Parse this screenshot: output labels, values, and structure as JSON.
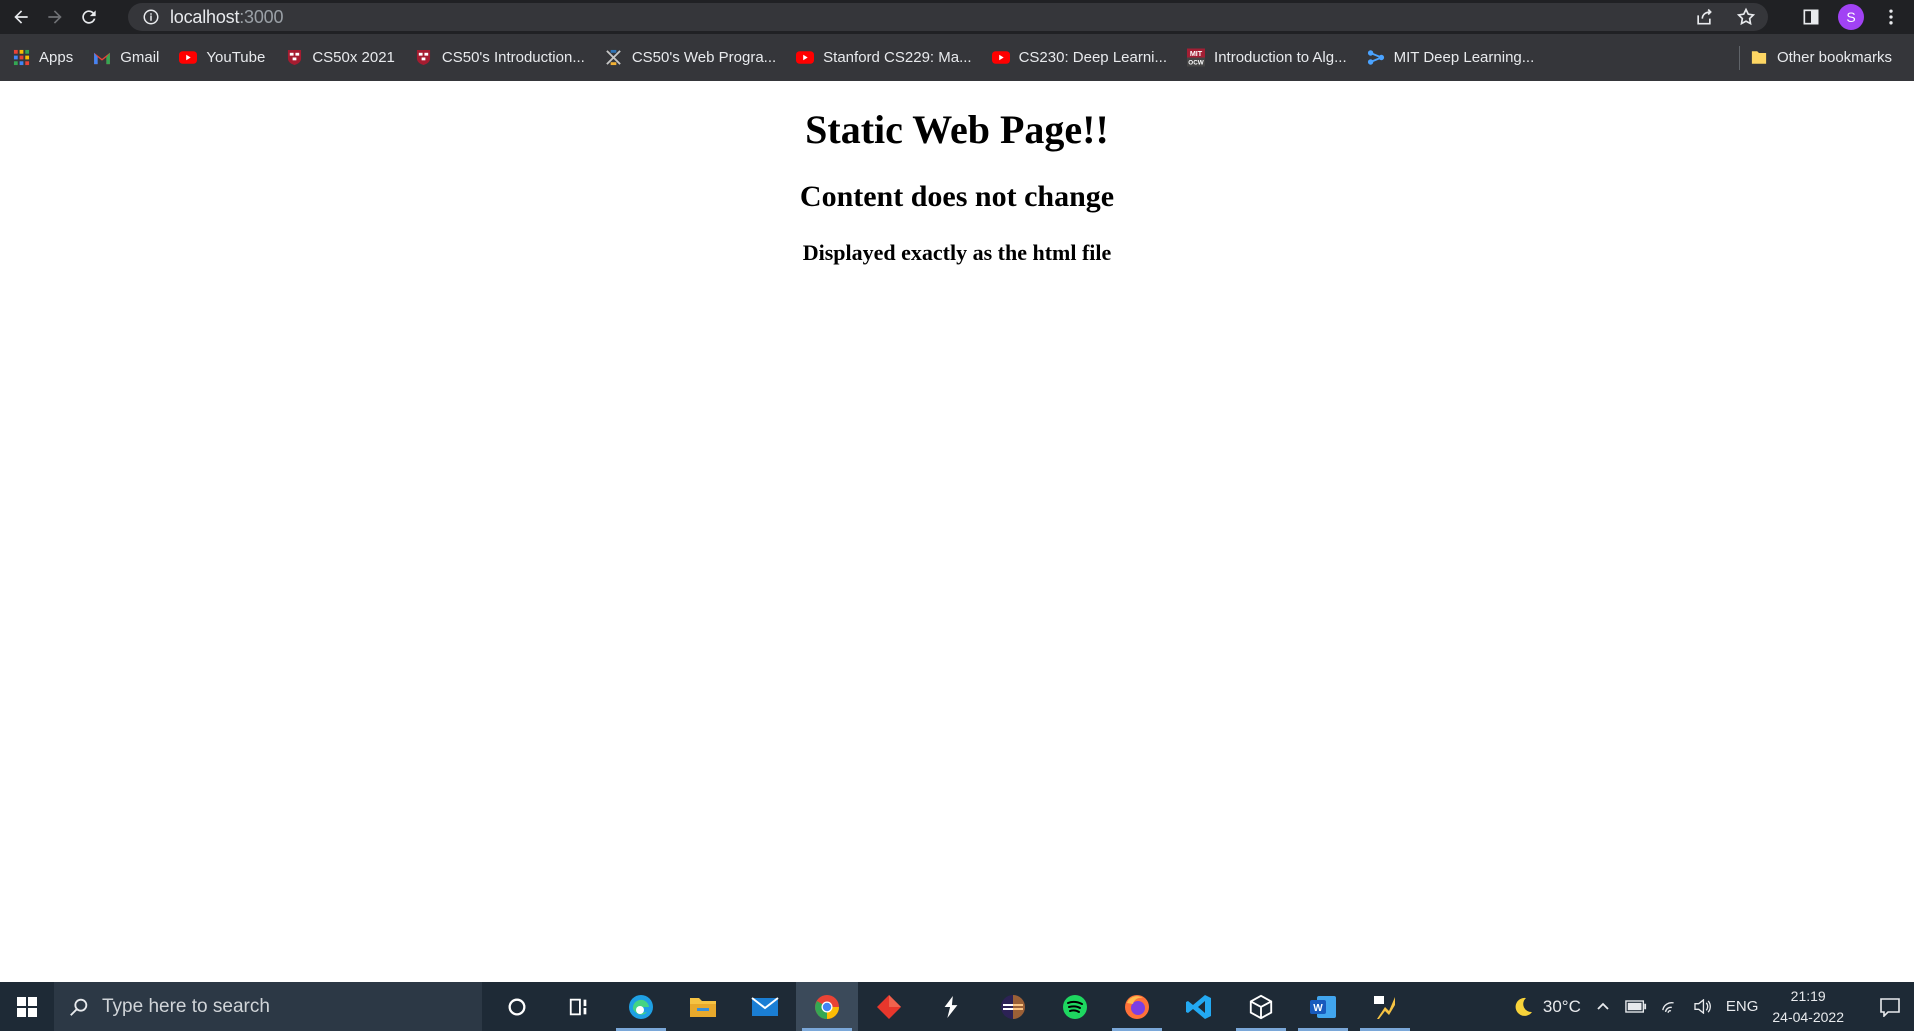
{
  "browser": {
    "url_host": "localhost",
    "url_port": ":3000",
    "profile_initial": "S"
  },
  "bookmarks": {
    "items": [
      {
        "label": "Apps",
        "icon": "apps-grid-icon"
      },
      {
        "label": "Gmail",
        "icon": "gmail-icon"
      },
      {
        "label": "YouTube",
        "icon": "youtube-icon"
      },
      {
        "label": "CS50x 2021",
        "icon": "harvard-icon"
      },
      {
        "label": "CS50's Introduction...",
        "icon": "harvard-icon"
      },
      {
        "label": "CS50's Web Progra...",
        "icon": "edx-icon"
      },
      {
        "label": "Stanford CS229: Ma...",
        "icon": "youtube-icon"
      },
      {
        "label": "CS230: Deep Learni...",
        "icon": "youtube-icon"
      },
      {
        "label": "Introduction to Alg...",
        "icon": "mit-ocw-icon"
      },
      {
        "label": "MIT Deep Learning...",
        "icon": "network-icon"
      }
    ],
    "other_label": "Other bookmarks"
  },
  "page": {
    "h1": "Static Web Page!!",
    "h2": "Content does not change",
    "h3": "Displayed exactly as the html file"
  },
  "taskbar": {
    "search_placeholder": "Type here to search",
    "weather": "30°C",
    "language": "ENG",
    "time": "21:19",
    "date": "24-04-2022",
    "mit_ocw_text": "MIT\nOCW"
  },
  "colors": {
    "chrome_dark": "#202124",
    "bookmarks_bg": "#35363a",
    "taskbar_bg": "#1e2a36",
    "profile": "#a142f4"
  }
}
